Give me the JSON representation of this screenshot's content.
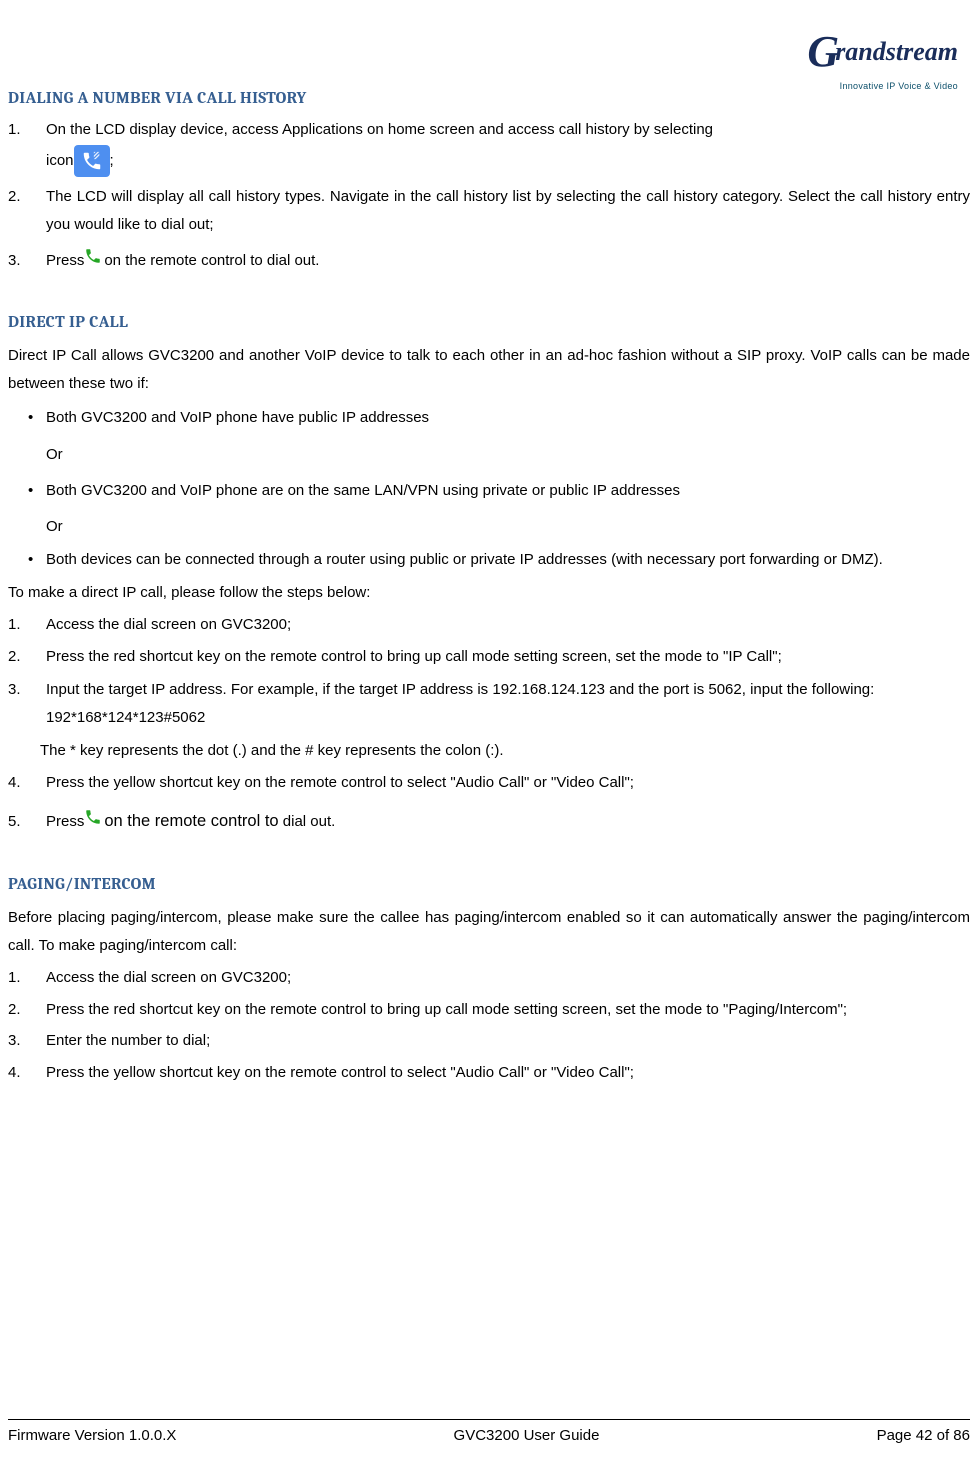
{
  "logo": {
    "brand": "Grandstream",
    "tagline": "Innovative IP Voice & Video"
  },
  "s1": {
    "heading": "DIALING A NUMBER VIA CALL HISTORY",
    "item1a": "On the LCD display device, access Applications on home screen and access call history by selecting",
    "item1b": "icon",
    "item1c": ";",
    "item2": "The LCD will display all call history types. Navigate in the call history list by selecting the call history category. Select the call history entry you would like to dial out;",
    "item3a": "Press",
    "item3b": "on the remote control to dial out."
  },
  "s2": {
    "heading": "DIRECT IP CALL",
    "intro": "Direct IP Call allows GVC3200 and another VoIP device to talk to each other in an ad-hoc fashion without a SIP proxy. VoIP calls can be made between these two if:",
    "b1": "Both GVC3200 and VoIP phone have public IP addresses",
    "or": "Or",
    "b2": "Both GVC3200 and VoIP phone are on the same LAN/VPN using private or public IP addresses",
    "b3": "Both devices can be connected through a router using public or private IP addresses (with necessary port forwarding or DMZ).",
    "steps_intro": "To make a direct IP call, please follow the steps below:",
    "n1": "Access the dial screen on GVC3200;",
    "n2": "Press the red shortcut key on the remote control to bring up call mode setting screen, set the mode to \"IP Call\";",
    "n3": "Input the target IP address. For example, if the target IP address is 192.168.124.123 and the port is 5062, input the following:",
    "n3_code": "192*168*124*123#5062",
    "n3_note": "The * key represents the dot (.) and the # key represents the colon (:).",
    "n4": "Press the yellow shortcut key on the remote control to select \"Audio Call\" or \"Video Call\";",
    "n5a": "Press",
    "n5b": "on the remote control to",
    "n5c": " dial out."
  },
  "s3": {
    "heading": "PAGING/INTERCOM",
    "intro": "Before placing paging/intercom, please make sure the callee has paging/intercom enabled so it can automatically answer the paging/intercom call. To make paging/intercom call:",
    "n1": "Access the dial screen on GVC3200;",
    "n2": "Press the red shortcut key on the remote control to bring up call mode setting screen, set the mode to \"Paging/Intercom\";",
    "n3": "Enter the number to dial;",
    "n4": "Press the yellow shortcut key on the remote control to select \"Audio Call\" or \"Video Call\";"
  },
  "footer": {
    "left": "Firmware Version 1.0.0.X",
    "center": "GVC3200 User Guide",
    "right": "Page 42 of 86"
  }
}
